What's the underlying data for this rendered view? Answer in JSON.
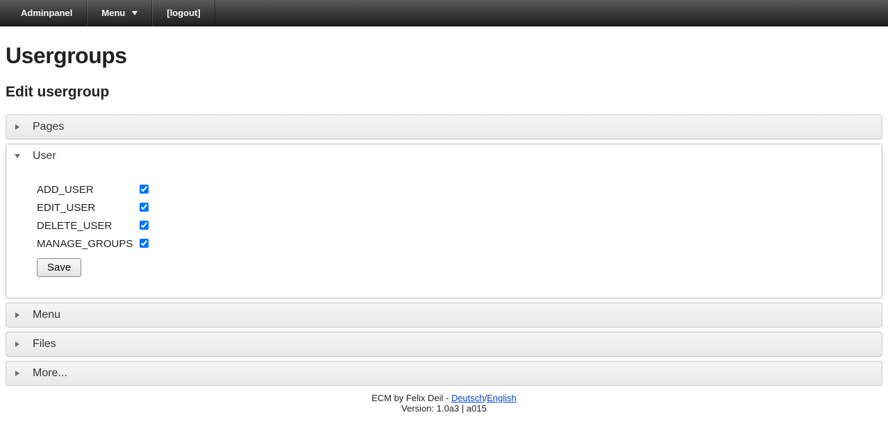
{
  "nav": {
    "adminpanel": "Adminpanel",
    "menu": "Menu",
    "logout": "[logout]"
  },
  "page": {
    "title": "Usergroups",
    "subtitle": "Edit usergroup"
  },
  "accordion": {
    "pages": {
      "label": "Pages"
    },
    "user": {
      "label": "User",
      "permissions": [
        {
          "name": "ADD_USER",
          "checked": true
        },
        {
          "name": "EDIT_USER",
          "checked": true
        },
        {
          "name": "DELETE_USER",
          "checked": true
        },
        {
          "name": "MANAGE_GROUPS",
          "checked": true
        }
      ],
      "save_label": "Save"
    },
    "menu": {
      "label": "Menu"
    },
    "files": {
      "label": "Files"
    },
    "more": {
      "label": "More..."
    }
  },
  "footer": {
    "credit_prefix": "ECM by Felix Deil - ",
    "lang_de": "Deutsch",
    "slash": "/",
    "lang_en": "English",
    "version": "Version: 1.0a3 | a015"
  }
}
